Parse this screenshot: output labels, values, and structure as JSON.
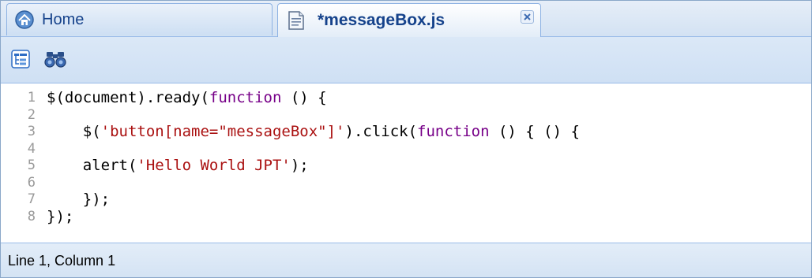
{
  "tabs": [
    {
      "label": "Home",
      "icon": "home-icon"
    },
    {
      "label": "*messageBox.js",
      "icon": "document-icon",
      "active": true,
      "close_icon": "close-icon"
    }
  ],
  "toolbar": {
    "buttons": [
      {
        "icon": "tree-view-icon"
      },
      {
        "icon": "binoculars-icon"
      }
    ]
  },
  "editor": {
    "line_numbers": [
      "1",
      "2",
      "3",
      "4",
      "5",
      "6",
      "7",
      "8"
    ],
    "lines": [
      [
        {
          "t": "$(document).ready(",
          "c": "plain"
        },
        {
          "t": "function",
          "c": "kw"
        },
        {
          "t": " () {",
          "c": "plain"
        }
      ],
      [],
      [
        {
          "t": "    $(",
          "c": "plain"
        },
        {
          "t": "'button[name=\"messageBox\"]'",
          "c": "str"
        },
        {
          "t": ").click(",
          "c": "plain"
        },
        {
          "t": "function",
          "c": "kw"
        },
        {
          "t": " () { () {",
          "c": "plain"
        }
      ],
      [],
      [
        {
          "t": "    alert(",
          "c": "plain"
        },
        {
          "t": "'Hello World JPT'",
          "c": "str"
        },
        {
          "t": ");",
          "c": "plain"
        }
      ],
      [],
      [
        {
          "t": "    });",
          "c": "plain"
        }
      ],
      [
        {
          "t": "});",
          "c": "plain"
        }
      ]
    ]
  },
  "colors": {
    "keyword": "#770088",
    "string": "#aa1111",
    "tab_text": "#15428b"
  },
  "status": {
    "text": "Line 1, Column 1"
  }
}
